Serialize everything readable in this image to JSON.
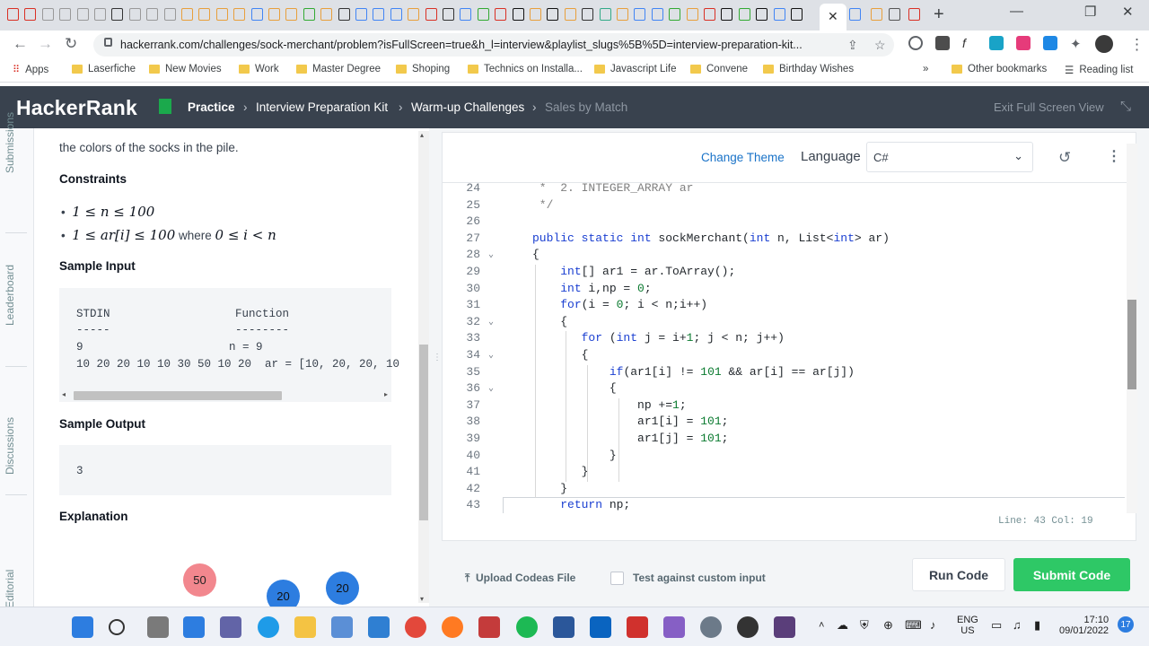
{
  "browser": {
    "active_tab_close": "✕",
    "new_tab": "+",
    "url": "hackerrank.com/challenges/sock-merchant/problem?isFullScreen=true&h_l=interview&playlist_slugs%5B%5D=interview-preparation-kit...",
    "window_controls": [
      "—",
      "❐",
      "✕"
    ],
    "extensions_more": "⋮"
  },
  "bookmarks": [
    "Apps",
    "Laserfiche",
    "New Movies",
    "Work",
    "Master Degree",
    "Shoping",
    "Technics on Installa...",
    "Javascript Life",
    "Convene",
    "Birthday Wishes"
  ],
  "bookmarks_overflow": "»",
  "bookmarks_right": [
    "Other bookmarks",
    "Reading list"
  ],
  "header": {
    "logo": "HackerRank",
    "crumbs": [
      "Practice",
      "Interview Preparation Kit",
      "Warm-up Challenges",
      "Sales by Match"
    ],
    "separators": [
      "›",
      "›",
      "›"
    ],
    "exit_fullscreen": "Exit Full Screen View"
  },
  "rail": [
    "Submissions",
    "Leaderboard",
    "Discussions",
    "Editorial"
  ],
  "problem": {
    "intro": "the colors of the socks in the pile.",
    "constraints_title": "Constraints",
    "constraint1": "1 ≤ n ≤ 100",
    "constraint2_math": "1 ≤ ar[i] ≤ 100",
    "constraint2_where": " where ",
    "constraint2_tail": "0 ≤ i < n",
    "sample_input_title": "Sample Input",
    "sample_input": {
      "col1_header": "STDIN",
      "col1_rule": "-----",
      "col2_header": "Function",
      "col2_rule": "--------",
      "row1_left": "9",
      "row1_right": "n = 9",
      "row2": "10 20 20 10 10 30 50 10 20  ar = [10, 20, 20, 10"
    },
    "sample_output_title": "Sample Output",
    "sample_output": "3",
    "explanation_title": "Explanation",
    "bubbles": [
      "50",
      "20",
      "20"
    ],
    "bubble_colors": [
      "#f2878e",
      "#2d7de0",
      "#2d7de0"
    ]
  },
  "editor": {
    "change_theme": "Change Theme",
    "language_label": "Language",
    "language_value": "C#",
    "status": "Line: 43 Col: 19",
    "lines": [
      {
        "n": "24",
        "fold": false,
        "html": "<span class='cm'> *  2. INTEGER_ARRAY ar</span>"
      },
      {
        "n": "25",
        "fold": false,
        "html": "<span class='cm'> */</span>"
      },
      {
        "n": "26",
        "fold": false,
        "html": ""
      },
      {
        "n": "27",
        "fold": false,
        "html": "<span class='kw'>public static int</span> sockMerchant(<span class='kw'>int</span> n, List&lt;<span class='kw'>int</span>&gt; ar)"
      },
      {
        "n": "28",
        "fold": true,
        "html": "{"
      },
      {
        "n": "29",
        "fold": false,
        "html": "    <span class='kw'>int</span>[] ar1 = ar.ToArray();"
      },
      {
        "n": "30",
        "fold": false,
        "html": "    <span class='kw'>int</span> i,np = <span class='nm'>0</span>;"
      },
      {
        "n": "31",
        "fold": false,
        "html": "    <span class='kw'>for</span>(i = <span class='nm'>0</span>; i &lt; n;i++)"
      },
      {
        "n": "32",
        "fold": true,
        "html": "    {"
      },
      {
        "n": "33",
        "fold": false,
        "html": "       <span class='kw'>for</span> (<span class='kw'>int</span> j = i+<span class='nm'>1</span>; j &lt; n; j++)"
      },
      {
        "n": "34",
        "fold": true,
        "html": "       {"
      },
      {
        "n": "35",
        "fold": false,
        "html": "           <span class='kw'>if</span>(ar1[i] != <span class='nm'>101</span> &amp;&amp; ar[i] == ar[j])"
      },
      {
        "n": "36",
        "fold": true,
        "html": "           {"
      },
      {
        "n": "37",
        "fold": false,
        "html": "               np +=<span class='nm'>1</span>;"
      },
      {
        "n": "38",
        "fold": false,
        "html": "               ar1[i] = <span class='nm'>101</span>;"
      },
      {
        "n": "39",
        "fold": false,
        "html": "               ar1[j] = <span class='nm'>101</span>;"
      },
      {
        "n": "40",
        "fold": false,
        "html": "           }"
      },
      {
        "n": "41",
        "fold": false,
        "html": "       }"
      },
      {
        "n": "42",
        "fold": false,
        "html": "    }"
      },
      {
        "n": "43",
        "fold": false,
        "html": "    <span class='kw'>return</span> np;"
      }
    ],
    "upload": "Upload Codeas File",
    "custom_input": "Test against custom input",
    "run": "Run Code",
    "submit": "Submit Code"
  },
  "taskbar": {
    "lang1": "ENG",
    "lang2": "US",
    "time": "17:10",
    "date": "09/01/2022",
    "notifications": "17"
  }
}
